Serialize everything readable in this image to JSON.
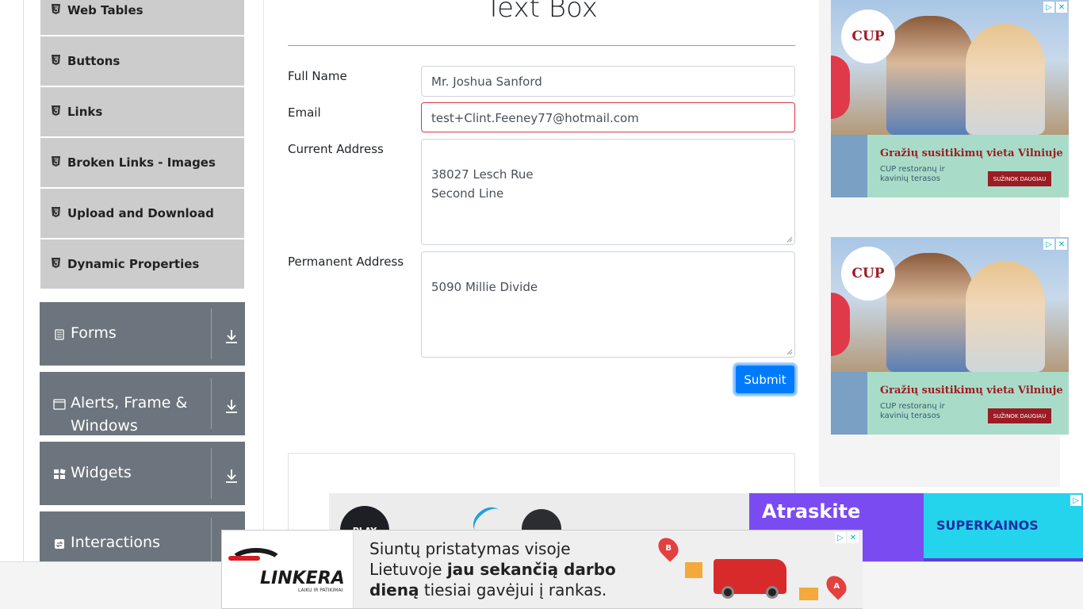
{
  "sidebar": {
    "elements_items": [
      {
        "label": "Web Tables"
      },
      {
        "label": "Buttons"
      },
      {
        "label": "Links"
      },
      {
        "label": "Broken Links - Images"
      },
      {
        "label": "Upload and Download"
      },
      {
        "label": "Dynamic Properties"
      }
    ],
    "groups": [
      {
        "label": "Forms"
      },
      {
        "label": "Alerts, Frame & Windows"
      },
      {
        "label": "Widgets"
      },
      {
        "label": "Interactions"
      }
    ]
  },
  "main": {
    "title": "Text Box",
    "form": {
      "full_name_label": "Full Name",
      "full_name_value": "Mr. Joshua Sanford",
      "email_label": "Email",
      "email_value": "test+Clint.Feeney77@hotmail.com",
      "current_address_label": "Current Address",
      "current_address_value": "38027 Lesch Rue\nSecond Line",
      "permanent_address_label": "Permanent Address",
      "permanent_address_value": "5090 Millie Divide",
      "submit_label": "Submit"
    }
  },
  "ads": {
    "right": [
      {
        "logo": "CUP",
        "headline": "Gražių susitikimų vieta Vilniuje",
        "sub": "CUP restoranų ir kavinių terasos",
        "cta": "SUŽINOK DAUGIAU"
      },
      {
        "logo": "CUP",
        "headline": "Gražių susitikimų vieta Vilniuje",
        "sub": "CUP restoranų ir kavinių terasos",
        "cta": "SUŽINOK DAUGIAU"
      }
    ],
    "bottom_strip": {
      "badge": "PLAY",
      "atraskite": "Atraskite",
      "superkainos": "SUPERKAINOS"
    },
    "linkera": {
      "brand": "LINKERA",
      "tagline": "LAIKU IR PATIKIMAI",
      "line1": "Siuntų pristatymas visoje",
      "line2_pre": "Lietuvoje ",
      "line2_bold": "jau sekančią darbo",
      "line3_bold": "dieną",
      "line3_post": " tiesiai gavėjui į rankas.",
      "pin_a": "A",
      "pin_b": "B"
    }
  },
  "colors": {
    "sidebar_item_bg": "#cccccc",
    "group_bg": "#6c757d",
    "submit_bg": "#007bff",
    "error_border": "#dc3545"
  }
}
